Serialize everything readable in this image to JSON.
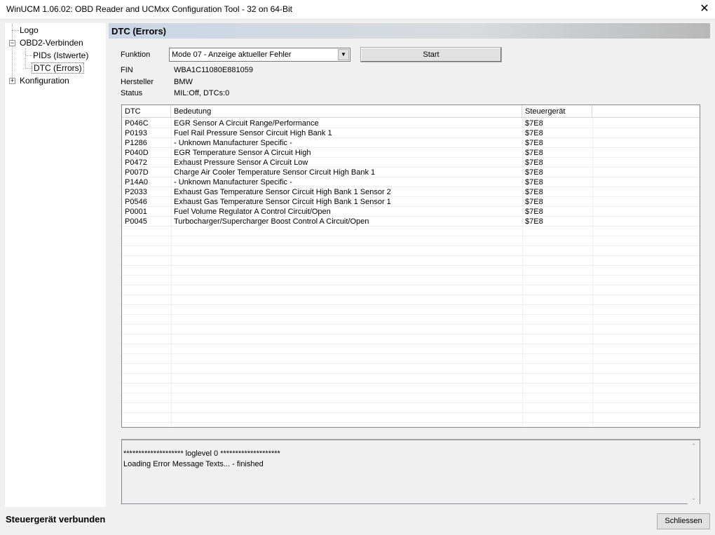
{
  "window": {
    "title": "WinUCM 1.06.02: OBD Reader and UCMxx Configuration Tool - 32 on 64-Bit",
    "close_glyph": "✕"
  },
  "tree": {
    "items": [
      {
        "label": "Logo"
      },
      {
        "label": "OBD2-Verbinden",
        "expander": "−"
      },
      {
        "label": "PIDs (Istwerte)"
      },
      {
        "label": "DTC (Errors)",
        "selected": true
      },
      {
        "label": "Konfiguration",
        "expander": "+"
      }
    ]
  },
  "panel": {
    "title": "DTC (Errors)",
    "funktion_label": "Funktion",
    "funktion_value": "Mode 07 - Anzeige aktueller Fehler",
    "start_label": "Start",
    "fin_label": "FIN",
    "fin_value": "WBA1C11080E881059",
    "hersteller_label": "Hersteller",
    "hersteller_value": "BMW",
    "status_label": "Status",
    "status_value": "MIL:Off, DTCs:0"
  },
  "table": {
    "columns": [
      "DTC",
      "Bedeutung",
      "Steuergerät"
    ],
    "rows": [
      [
        "P046C",
        "EGR Sensor A Circuit Range/Performance",
        "$7E8"
      ],
      [
        "P0193",
        "Fuel Rail Pressure Sensor Circuit High Bank 1",
        "$7E8"
      ],
      [
        "P1286",
        "- Unknown Manufacturer Specific -",
        "$7E8"
      ],
      [
        "P040D",
        "EGR Temperature Sensor A Circuit High",
        "$7E8"
      ],
      [
        "P0472",
        "Exhaust Pressure Sensor A Circuit Low",
        "$7E8"
      ],
      [
        "P007D",
        "Charge Air Cooler Temperature Sensor Circuit High Bank 1",
        "$7E8"
      ],
      [
        "P14A0",
        "- Unknown Manufacturer Specific -",
        "$7E8"
      ],
      [
        "P2033",
        "Exhaust Gas Temperature Sensor Circuit High Bank 1 Sensor 2",
        "$7E8"
      ],
      [
        "P0546",
        "Exhaust Gas Temperature Sensor Circuit High Bank 1 Sensor 1",
        "$7E8"
      ],
      [
        "P0001",
        "Fuel Volume Regulator A Control Circuit/Open",
        "$7E8"
      ],
      [
        "P0045",
        "Turbocharger/Supercharger Boost Control A Circuit/Open",
        "$7E8"
      ]
    ]
  },
  "log": {
    "lines": [
      "******************** loglevel 0 ********************",
      "Loading Error Message Texts... - finished"
    ],
    "scroll_up": "⌃",
    "scroll_down": "⌄"
  },
  "footer": {
    "status_text": "Steuergerät verbunden",
    "close_label": "Schliessen"
  }
}
